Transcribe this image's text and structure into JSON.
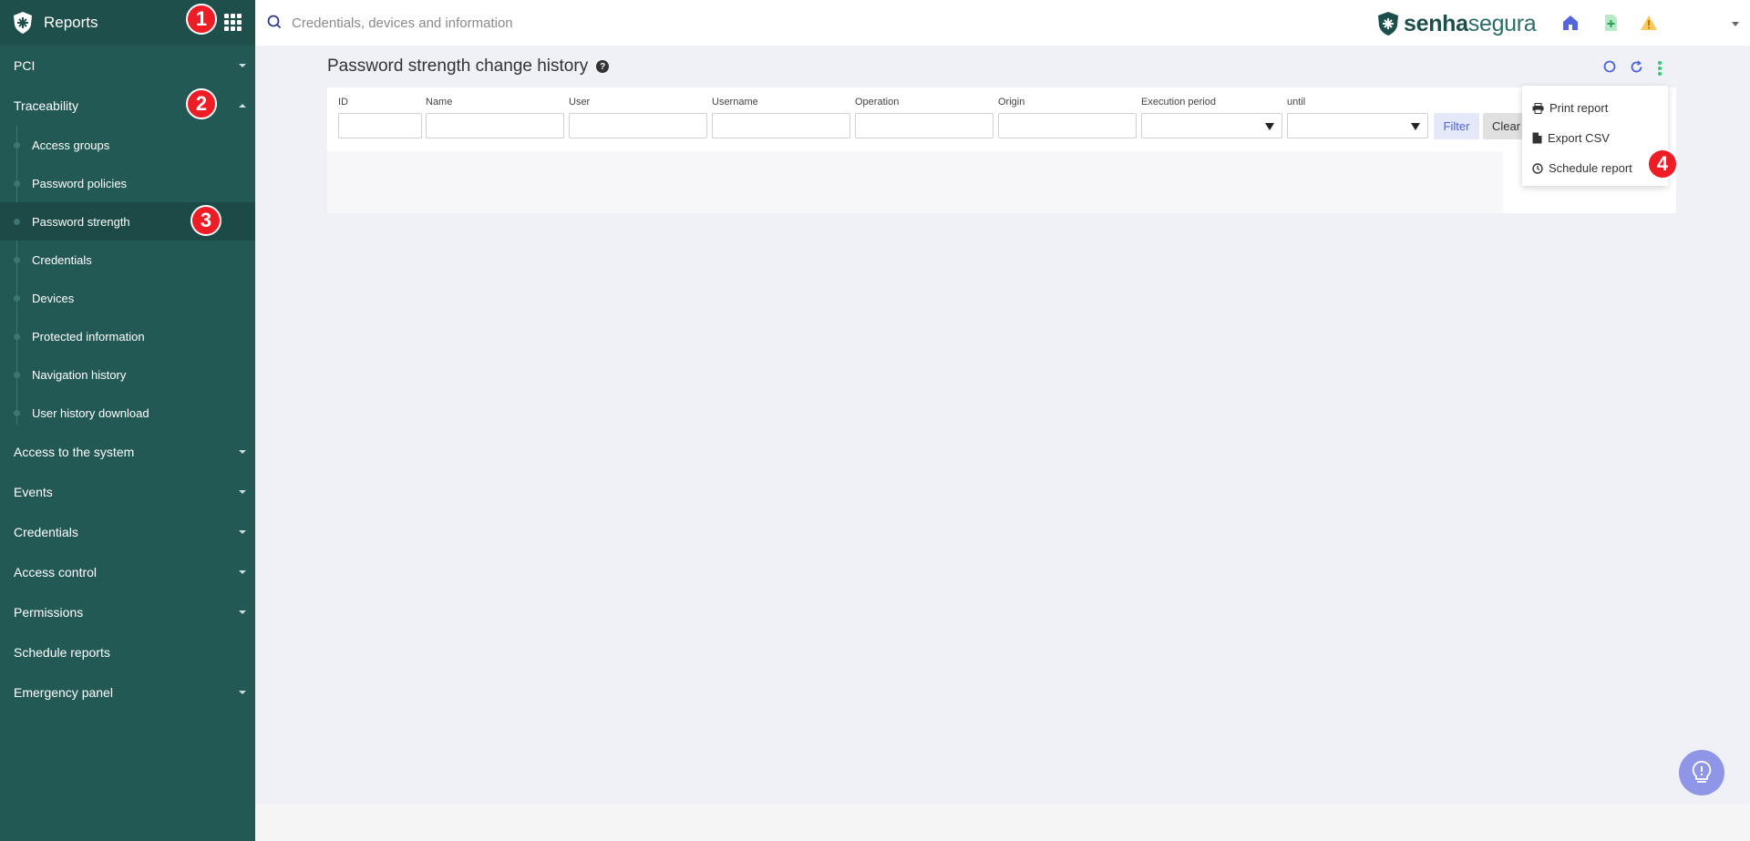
{
  "sidebar": {
    "title": "Reports",
    "items": [
      {
        "label": "PCI"
      },
      {
        "label": "Traceability"
      },
      {
        "label": "Access to the system"
      },
      {
        "label": "Events"
      },
      {
        "label": "Credentials"
      },
      {
        "label": "Access control"
      },
      {
        "label": "Permissions"
      },
      {
        "label": "Schedule reports"
      },
      {
        "label": "Emergency panel"
      }
    ],
    "traceability_sub": [
      {
        "label": "Access groups"
      },
      {
        "label": "Password policies"
      },
      {
        "label": "Password strength"
      },
      {
        "label": "Credentials"
      },
      {
        "label": "Devices"
      },
      {
        "label": "Protected information"
      },
      {
        "label": "Navigation history"
      },
      {
        "label": "User history download"
      }
    ]
  },
  "topbar": {
    "search_placeholder": "Credentials, devices and information",
    "brand_bold": "senha",
    "brand_light": "segura"
  },
  "page": {
    "title": "Password strength change history",
    "help": "?"
  },
  "filters": {
    "id": "ID",
    "name": "Name",
    "user": "User",
    "username": "Username",
    "operation": "Operation",
    "origin": "Origin",
    "execution_period": "Execution period",
    "until": "until",
    "filter_button": "Filter",
    "clear_button": "Clear"
  },
  "menu": {
    "print": "Print report",
    "export": "Export CSV",
    "schedule": "Schedule report"
  },
  "badges": {
    "b1": "1",
    "b2": "2",
    "b3": "3",
    "b4": "4"
  },
  "colors": {
    "sidebar": "#235955",
    "accent": "#4a63d8",
    "badge": "#ee1c24"
  }
}
